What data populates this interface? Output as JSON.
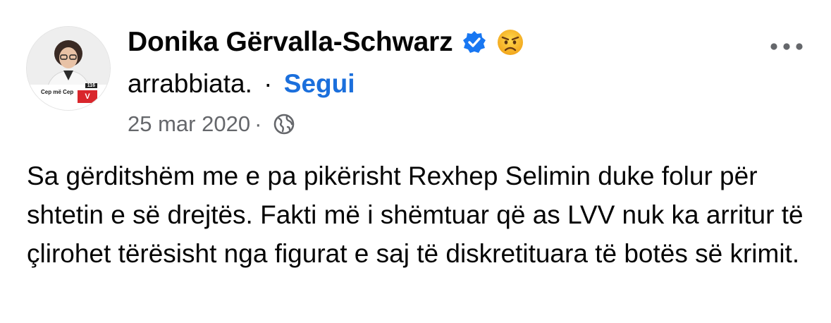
{
  "post": {
    "author_name": "Donika Gërvalla-Schwarz",
    "feeling_text": "arrabbiata.",
    "separator": "·",
    "follow_label": "Segui",
    "date": "25 mar 2020",
    "date_separator": "·",
    "body": "Sa gërditshëm me e pa pikërisht Rexhep Selimin duke folur për shtetin e së drejtës. Fakti më i shëmtuar që as LVV nuk ka arritur të çlirohet tërësisht nga figurat e saj të diskretituara të botës së krimit.",
    "icons": {
      "verified": "verified-badge-icon",
      "feeling": "angry-face-emoji-icon",
      "privacy": "globe-icon",
      "more": "more-options-icon"
    },
    "avatar": {
      "banner_text": "Cep më Cep",
      "list_number": "116",
      "badge_text": "V"
    },
    "colors": {
      "link": "#1b6fdc",
      "verified": "#1877f2",
      "meta_text": "#65676b",
      "body_text": "#050505"
    }
  }
}
